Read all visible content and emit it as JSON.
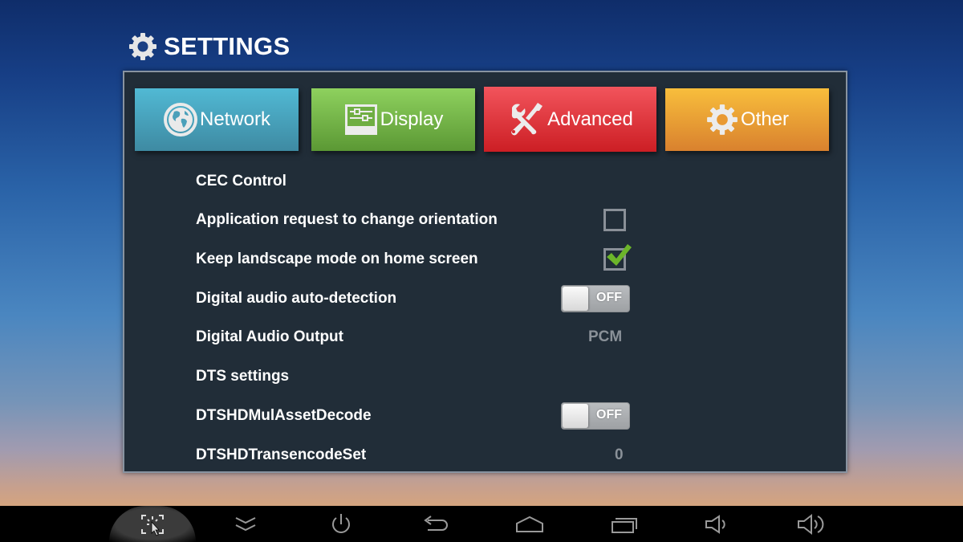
{
  "header": {
    "title": "SETTINGS",
    "icon": "gear-icon"
  },
  "tabs": [
    {
      "label": "Network",
      "icon": "globe-icon",
      "color": "#4aa7c2"
    },
    {
      "label": "Display",
      "icon": "display-settings-icon",
      "color": "#74b84a"
    },
    {
      "label": "Advanced",
      "icon": "wrench-screwdriver-icon",
      "color": "#e23a40",
      "selected": true
    },
    {
      "label": "Other",
      "icon": "gear-icon",
      "color": "#ee9f34"
    }
  ],
  "settings": [
    {
      "label": "CEC Control",
      "control": "none"
    },
    {
      "label": "Application request to change orientation",
      "control": "checkbox",
      "checked": false
    },
    {
      "label": "Keep landscape mode on home screen",
      "control": "checkbox",
      "checked": true
    },
    {
      "label": "Digital audio auto-detection",
      "control": "toggle",
      "state": "OFF"
    },
    {
      "label": "Digital Audio Output",
      "control": "value",
      "value": "PCM"
    },
    {
      "label": "DTS settings",
      "control": "none"
    },
    {
      "label": "DTSHDMulAssetDecode",
      "control": "toggle",
      "state": "OFF"
    },
    {
      "label": "DTSHDTransencodeSet",
      "control": "value",
      "value": "0"
    }
  ],
  "navbar": {
    "buttons": [
      {
        "name": "screenshot-cursor-button",
        "icon": "cursor-select-icon",
        "active": true
      },
      {
        "name": "collapse-button",
        "icon": "double-chevron-down-icon"
      },
      {
        "name": "power-button",
        "icon": "power-icon"
      },
      {
        "name": "back-button",
        "icon": "back-arrow-icon"
      },
      {
        "name": "home-button",
        "icon": "home-icon"
      },
      {
        "name": "recent-apps-button",
        "icon": "recent-apps-icon"
      },
      {
        "name": "volume-down-button",
        "icon": "volume-down-icon"
      },
      {
        "name": "volume-up-button",
        "icon": "volume-up-icon"
      }
    ]
  },
  "colors": {
    "panel_bg": "#212d38",
    "checkmark": "#6cb52a"
  }
}
